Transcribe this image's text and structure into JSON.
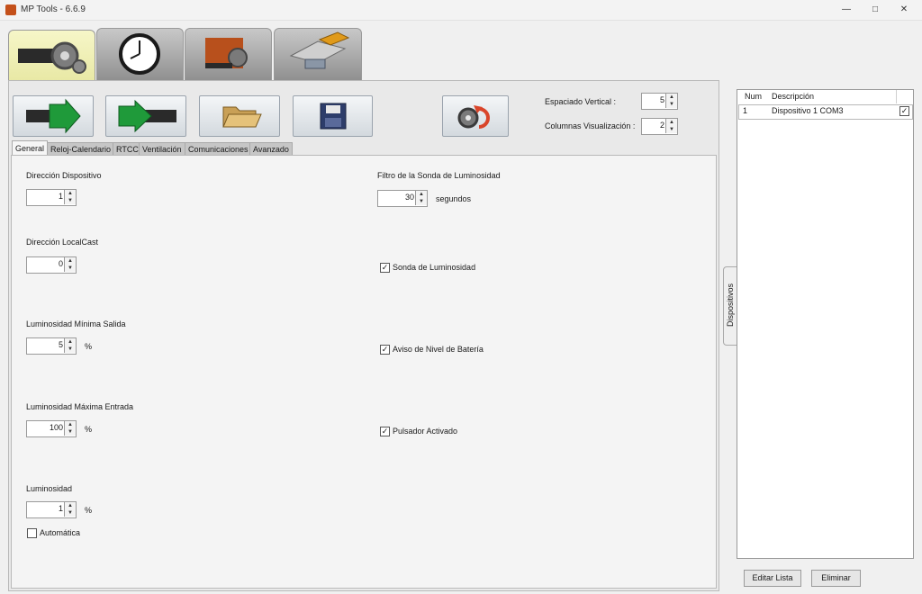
{
  "window": {
    "title": "MP Tools - 6.6.9"
  },
  "top_tabs": [
    {
      "icon": "gear-card-icon",
      "active": true
    },
    {
      "icon": "clock-icon",
      "active": false
    },
    {
      "icon": "mp-tools-logo-icon",
      "active": false
    },
    {
      "icon": "serial-cable-icon",
      "active": false
    }
  ],
  "toolbar": {
    "icons": [
      "read-device-arrow-icon",
      "write-device-arrow-icon",
      "open-folder-icon",
      "save-disk-icon",
      "reset-settings-icon"
    ],
    "espaciado_label": "Espaciado Vertical :",
    "espaciado_value": "5",
    "columnas_label": "Columnas Visualización :",
    "columnas_value": "2"
  },
  "sub_tabs": [
    "General",
    "Reloj-Calendario",
    "RTCC",
    "Ventilación",
    "Comunicaciones",
    "Avanzado"
  ],
  "general": {
    "direccion_dispositivo": {
      "label": "Dirección Dispositivo",
      "value": "1"
    },
    "direccion_localcast": {
      "label": "Dirección LocalCast",
      "value": "0"
    },
    "lum_min_salida": {
      "label": "Luminosidad Mínima Salida",
      "value": "5",
      "unit": "%"
    },
    "lum_max_entrada": {
      "label": "Luminosidad Máxima Entrada",
      "value": "100",
      "unit": "%"
    },
    "luminosidad": {
      "label": "Luminosidad",
      "value": "1",
      "unit": "%"
    },
    "automatica": {
      "label": "Automática",
      "checked": false
    },
    "filtro_sonda": {
      "label": "Filtro de la Sonda de Luminosidad",
      "value": "30",
      "unit": "segundos"
    },
    "sonda": {
      "label": "Sonda de Luminosidad",
      "checked": true
    },
    "aviso_bateria": {
      "label": "Aviso de Nivel de Batería",
      "checked": true
    },
    "pulsador": {
      "label": "Pulsador Activado",
      "checked": true
    }
  },
  "devices": {
    "side_tab_label": "Dispositivos",
    "columns": [
      "Num",
      "Descripción"
    ],
    "rows": [
      {
        "num": "1",
        "descripcion": "Dispositivo 1 COM3",
        "checked": true
      }
    ],
    "edit_button": "Editar Lista",
    "delete_button": "Eliminar"
  },
  "colors": {
    "accent_tab": "#e8e8a4",
    "arrow_green": "#1f9a3a",
    "reset_red": "#d9452a"
  }
}
